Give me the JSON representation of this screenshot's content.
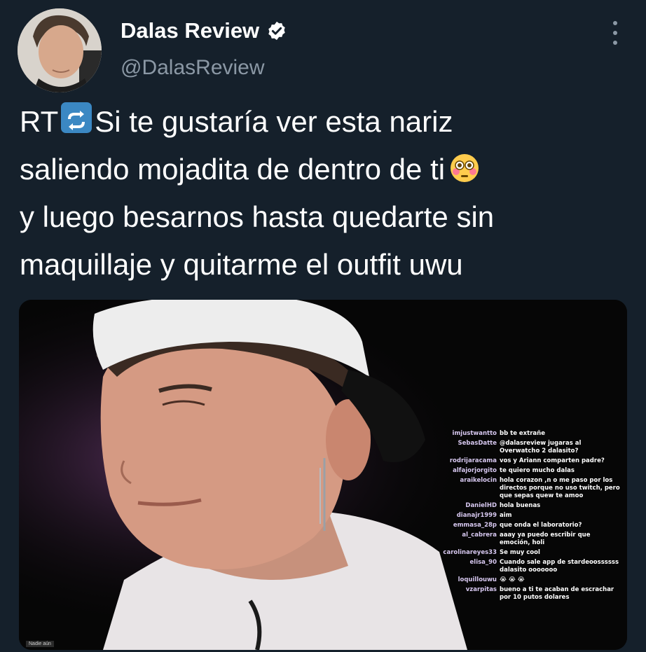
{
  "header": {
    "display_name": "Dalas Review",
    "handle": "@DalasReview"
  },
  "tweet": {
    "lines": [
      {
        "prefix": "RT",
        "text": "Si te gustaría ver esta nariz"
      },
      {
        "text": "saliendo mojadita de dentro de ti"
      },
      {
        "text": "y luego besarnos hasta quedarte sin"
      },
      {
        "text": "maquillaje y quitarme el outfit uwu"
      }
    ]
  },
  "icons": {
    "verified": "verified-badge-icon",
    "retweet_emoji": "repeat-emoji-icon",
    "flushed_emoji": "flushed-face-emoji-icon",
    "more": "more-options-icon"
  },
  "colors": {
    "background": "#15202b",
    "secondary_text": "#8b98a5",
    "verified_blue": "#1d9bf0"
  },
  "media": {
    "chat": [
      {
        "user": "imjustwantto",
        "msg": "bb te extrañe"
      },
      {
        "user": "SebasDatte",
        "msg": "@dalasreview jugaras al Overwatcho 2 dalasito?"
      },
      {
        "user": "rodrijaracama",
        "msg": "vos y Ariann comparten padre?"
      },
      {
        "user": "alfajorjorgito",
        "msg": "te quiero mucho dalas"
      },
      {
        "user": "araikelocin",
        "msg": "hola corazon ,n o me paso por los directos porque no uso twitch, pero que sepas quew te amoo"
      },
      {
        "user": "DanielHD",
        "msg": "hola buenas"
      },
      {
        "user": "dianajr1999",
        "msg": "aim"
      },
      {
        "user": "emmasa_28p",
        "msg": "que onda el laboratorio?"
      },
      {
        "user": "al_cabrera",
        "msg": "aaay ya puedo escribir que emoción, holi"
      },
      {
        "user": "carolinareyes33",
        "msg": "Se muy cool"
      },
      {
        "user": "elisa_90",
        "msg": "Cuando sale app de stardeoossssss dalasito ooooooo"
      },
      {
        "user": "loquillouwu",
        "msg": "😭 😭 😭"
      },
      {
        "user": "vzarpitas",
        "msg": "bueno a ti te acaban de escrachar por 10 putos dolares"
      }
    ],
    "watermark": "Nadie aún"
  }
}
